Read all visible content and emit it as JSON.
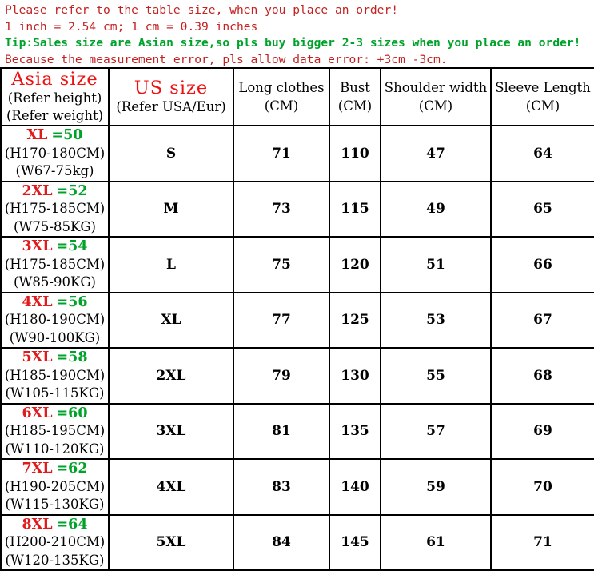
{
  "notices": [
    {
      "text": "Please refer to the table size, when you place an order!",
      "color": "red"
    },
    {
      "text": "1 inch = 2.54 cm; 1 cm = 0.39 inches",
      "color": "red"
    },
    {
      "text": "Tip:Sales size are Asian size,so pls buy bigger 2-3 sizes when you place an order!",
      "color": "green"
    },
    {
      "text": "Because the measurement error, pls allow data error: +3cm -3cm.",
      "color": "red"
    }
  ],
  "colors": {
    "red": "#c42121",
    "green": "#00a32a",
    "header_red": "#ee1111",
    "size_red": "#e01b1b",
    "border": "#000000"
  },
  "table": {
    "headers": {
      "asia": {
        "title": "Asia size",
        "sub1": "(Refer height)",
        "sub2": "(Refer weight)"
      },
      "us": {
        "title": "US size",
        "sub1": "(Refer USA/Eur)"
      },
      "long_clothes": {
        "line1": "Long clothes",
        "line2": "(CM)"
      },
      "bust": {
        "line1": "Bust",
        "line2": "(CM)"
      },
      "shoulder": {
        "line1": "Shoulder width",
        "line2": "(CM)"
      },
      "sleeve": {
        "line1": "Sleeve Length",
        "line2": "(CM)"
      }
    },
    "rows": [
      {
        "asia_size": "XL",
        "asia_eq": "=50",
        "height": "(H170-180CM)",
        "weight": "(W67-75kg)",
        "us": "S",
        "long_clothes": "71",
        "bust": "110",
        "shoulder": "47",
        "sleeve": "64"
      },
      {
        "asia_size": "2XL",
        "asia_eq": "=52",
        "height": "(H175-185CM)",
        "weight": "(W75-85KG)",
        "us": "M",
        "long_clothes": "73",
        "bust": "115",
        "shoulder": "49",
        "sleeve": "65"
      },
      {
        "asia_size": "3XL",
        "asia_eq": "=54",
        "height": "(H175-185CM)",
        "weight": "(W85-90KG)",
        "us": "L",
        "long_clothes": "75",
        "bust": "120",
        "shoulder": "51",
        "sleeve": "66"
      },
      {
        "asia_size": "4XL",
        "asia_eq": "=56",
        "height": "(H180-190CM)",
        "weight": "(W90-100KG)",
        "us": "XL",
        "long_clothes": "77",
        "bust": "125",
        "shoulder": "53",
        "sleeve": "67"
      },
      {
        "asia_size": "5XL",
        "asia_eq": "=58",
        "height": "(H185-190CM)",
        "weight": "(W105-115KG)",
        "us": "2XL",
        "long_clothes": "79",
        "bust": "130",
        "shoulder": "55",
        "sleeve": "68"
      },
      {
        "asia_size": "6XL",
        "asia_eq": "=60",
        "height": "(H185-195CM)",
        "weight": "(W110-120KG)",
        "us": "3XL",
        "long_clothes": "81",
        "bust": "135",
        "shoulder": "57",
        "sleeve": "69"
      },
      {
        "asia_size": "7XL",
        "asia_eq": "=62",
        "height": "(H190-205CM)",
        "weight": "(W115-130KG)",
        "us": "4XL",
        "long_clothes": "83",
        "bust": "140",
        "shoulder": "59",
        "sleeve": "70"
      },
      {
        "asia_size": "8XL",
        "asia_eq": "=64",
        "height": "(H200-210CM)",
        "weight": "(W120-135KG)",
        "us": "5XL",
        "long_clothes": "84",
        "bust": "145",
        "shoulder": "61",
        "sleeve": "71"
      }
    ]
  }
}
